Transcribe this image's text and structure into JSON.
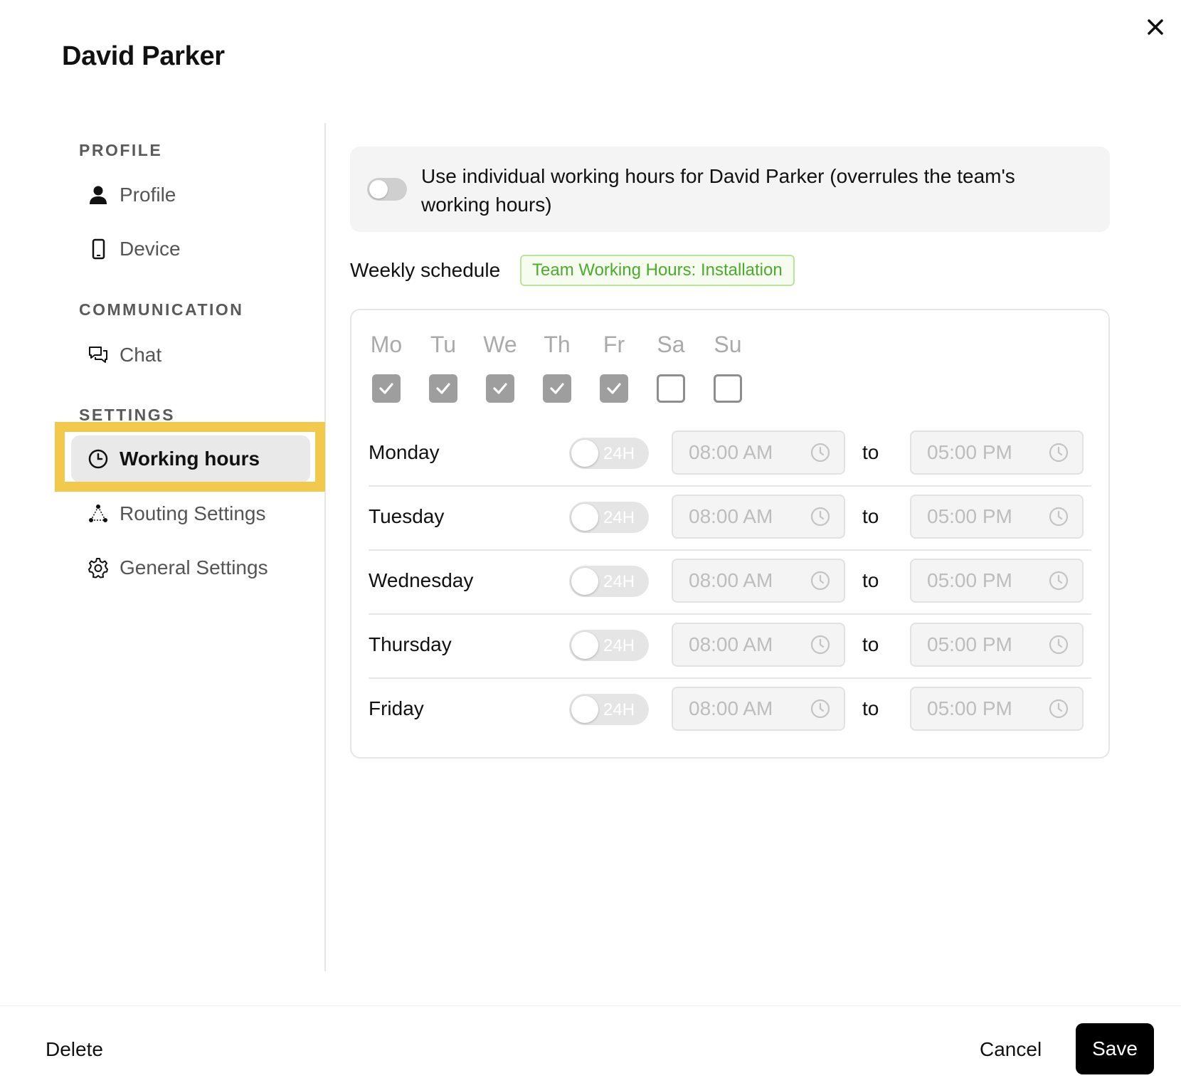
{
  "header": {
    "title": "David Parker"
  },
  "sidebar": {
    "sections": [
      {
        "label": "PROFILE"
      },
      {
        "label": "COMMUNICATION"
      },
      {
        "label": "SETTINGS"
      }
    ],
    "items": [
      {
        "label": "Profile",
        "icon": "person-icon"
      },
      {
        "label": "Device",
        "icon": "phone-icon"
      },
      {
        "label": "Chat",
        "icon": "chat-icon"
      },
      {
        "label": "Working hours",
        "icon": "clock-icon",
        "active": true
      },
      {
        "label": "Routing Settings",
        "icon": "routing-icon"
      },
      {
        "label": "General Settings",
        "icon": "gear-icon"
      }
    ],
    "highlight_color": "#f2c94c"
  },
  "main": {
    "override": {
      "enabled": false,
      "text": "Use individual working hours for David Parker (overrules the team's working hours)"
    },
    "weekly_title": "Weekly schedule",
    "team_badge": "Team Working Hours: Installation",
    "days": [
      {
        "abbr": "Mo",
        "checked": true
      },
      {
        "abbr": "Tu",
        "checked": true
      },
      {
        "abbr": "We",
        "checked": true
      },
      {
        "abbr": "Th",
        "checked": true
      },
      {
        "abbr": "Fr",
        "checked": true
      },
      {
        "abbr": "Sa",
        "checked": false
      },
      {
        "abbr": "Su",
        "checked": false
      }
    ],
    "rows": [
      {
        "day": "Monday",
        "toggle_label": "24H",
        "start": "08:00 AM",
        "to": "to",
        "end": "05:00 PM"
      },
      {
        "day": "Tuesday",
        "toggle_label": "24H",
        "start": "08:00 AM",
        "to": "to",
        "end": "05:00 PM"
      },
      {
        "day": "Wednesday",
        "toggle_label": "24H",
        "start": "08:00 AM",
        "to": "to",
        "end": "05:00 PM"
      },
      {
        "day": "Thursday",
        "toggle_label": "24H",
        "start": "08:00 AM",
        "to": "to",
        "end": "05:00 PM"
      },
      {
        "day": "Friday",
        "toggle_label": "24H",
        "start": "08:00 AM",
        "to": "to",
        "end": "05:00 PM"
      }
    ]
  },
  "footer": {
    "delete_label": "Delete",
    "cancel_label": "Cancel",
    "save_label": "Save"
  },
  "colors": {
    "accent_badge": "#4caa2e",
    "primary_button": "#000000"
  }
}
